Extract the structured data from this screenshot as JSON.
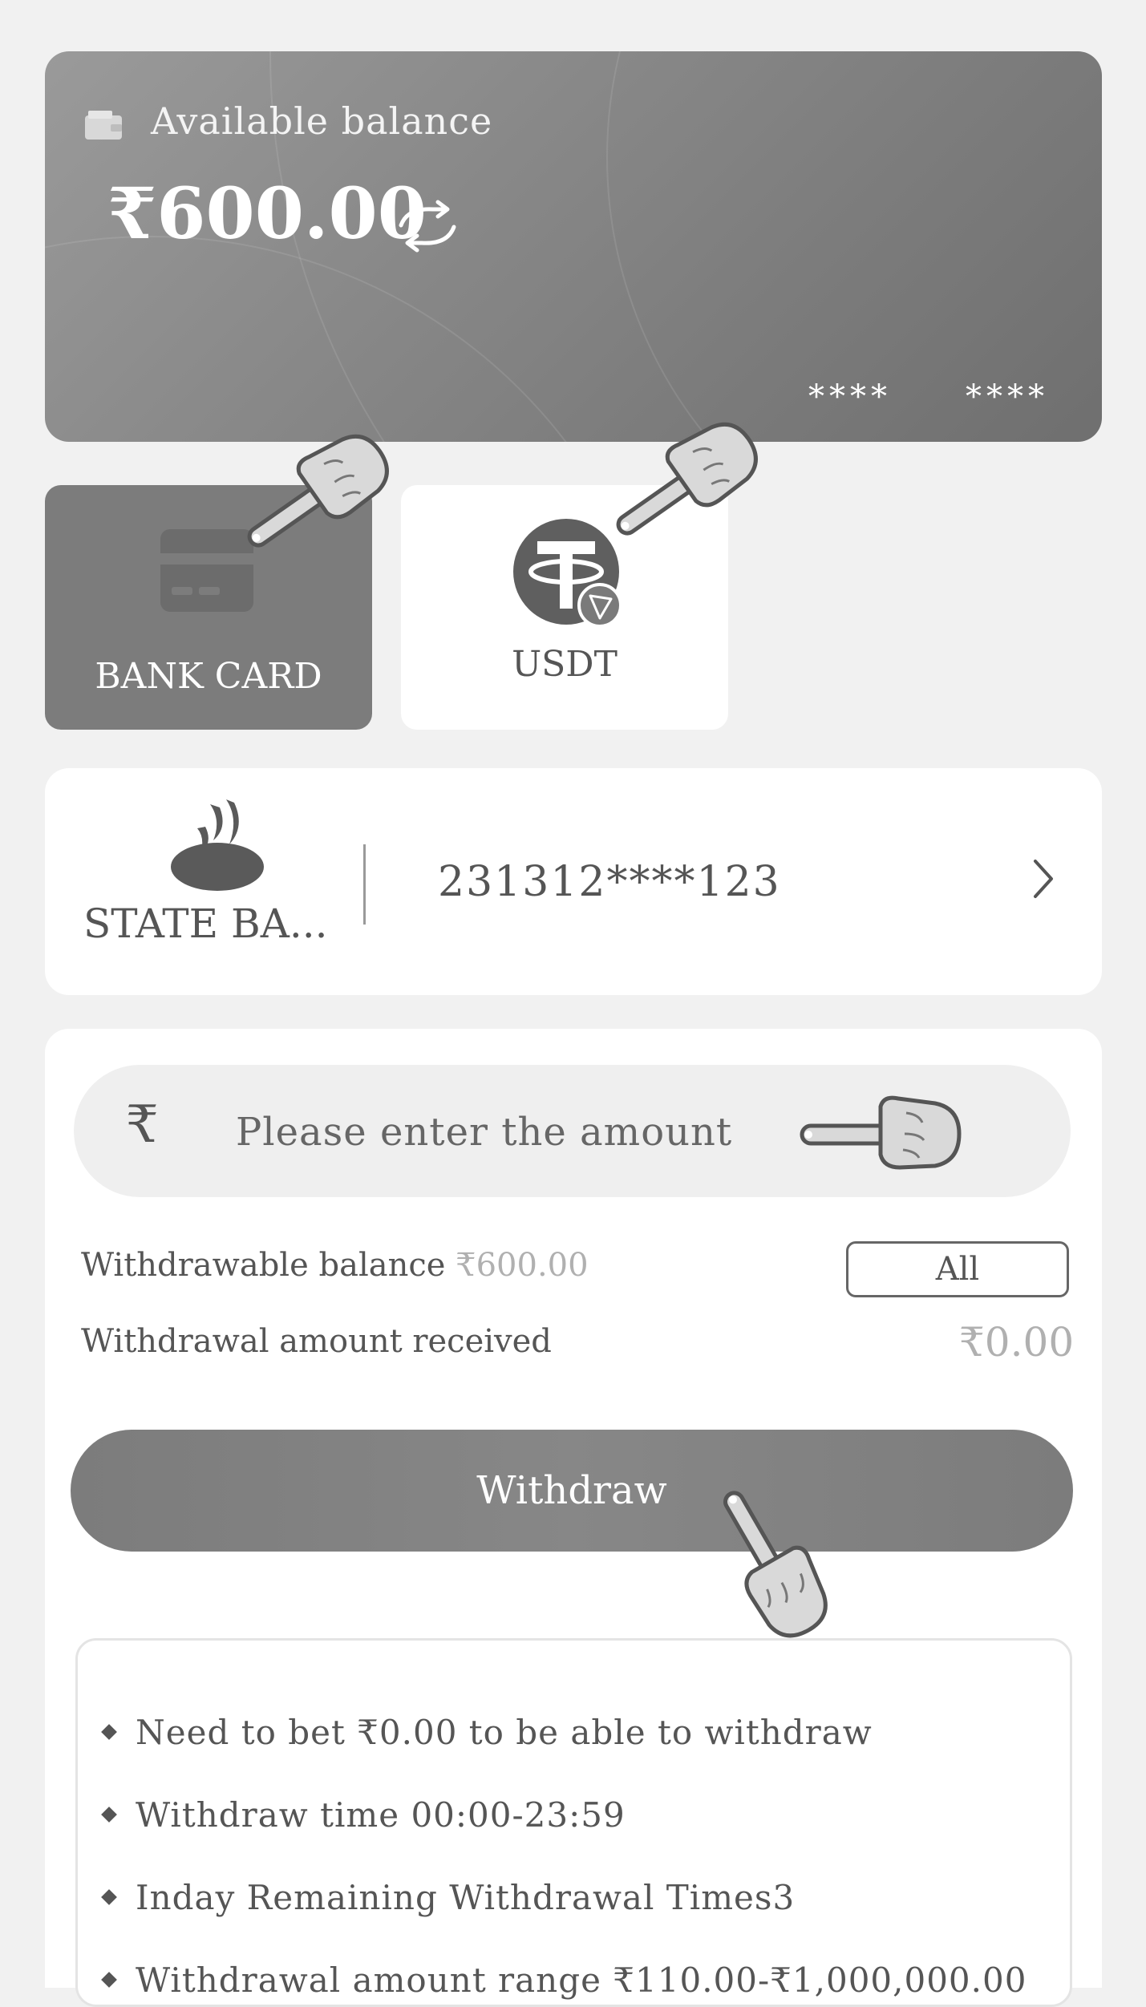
{
  "balance": {
    "label": "Available balance",
    "amount": "₹600.00",
    "card_mask_1": "****",
    "card_mask_2": "****"
  },
  "methods": [
    {
      "label": "BANK CARD",
      "icon": "bank-card-icon",
      "selected": true
    },
    {
      "label": "USDT",
      "icon": "usdt-tron-icon",
      "selected": false
    }
  ],
  "bank_account": {
    "bank_name": "STATE BA...",
    "account_number": "231312****123"
  },
  "amount_input": {
    "prefix": "₹",
    "placeholder": "Please enter the amount",
    "value": ""
  },
  "withdrawable": {
    "label": "Withdrawable balance",
    "value": "₹600.00",
    "all_button": "All"
  },
  "received": {
    "label": "Withdrawal amount received",
    "value": "₹0.00"
  },
  "withdraw_button": "Withdraw",
  "rules": [
    "Need to bet ₹0.00 to be able to withdraw",
    "Withdraw time 00:00-23:59",
    "Inday Remaining Withdrawal Times3",
    "Withdrawal amount range ₹110.00-₹1,000,000.00"
  ],
  "colors": {
    "card_gradient_start": "#9a9a9a",
    "card_gradient_end": "#6f6f6f",
    "selected_tile": "#7c7c7c",
    "button": "#7c7c7c",
    "page_background": "#f1f1f1"
  }
}
